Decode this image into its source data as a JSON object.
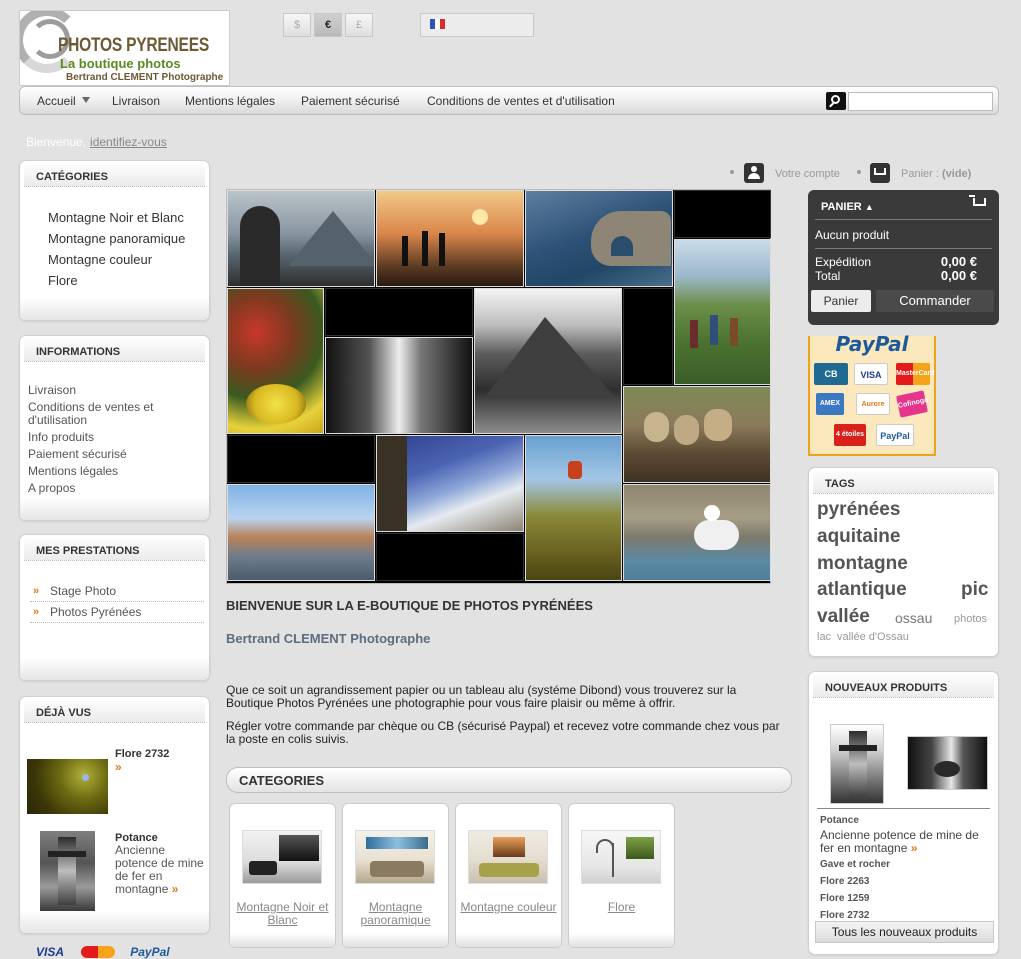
{
  "header": {
    "logo": {
      "title": "PHOTOS PYRENEES",
      "tagline": "La boutique photos",
      "author": "Bertrand CLEMENT Photographe"
    },
    "currencies": [
      "$",
      "€",
      "£"
    ],
    "active_currency": "€",
    "language_flag": "flag-fr-icon"
  },
  "nav": {
    "items": [
      "Accueil",
      "Livraison",
      "Mentions légales",
      "Paiement sécurisé",
      "Conditions de ventes et d'utilisation"
    ],
    "search_placeholder": ""
  },
  "welcome": {
    "text": "Bienvenue,",
    "login_link": "identifiez-vous"
  },
  "categories_box": {
    "title": "CATÉGORIES",
    "items": [
      "Montagne Noir et Blanc",
      "Montagne panoramique",
      "Montagne couleur",
      "Flore"
    ]
  },
  "informations_box": {
    "title": "INFORMATIONS",
    "items": [
      "Livraison",
      "Conditions de ventes et d'utilisation",
      "Info produits",
      "Paiement sécurisé",
      "Mentions légales",
      "A propos"
    ]
  },
  "prestations_box": {
    "title": "MES PRESTATIONS",
    "items": [
      "Stage Photo",
      "Photos Pyrénées"
    ]
  },
  "viewed_box": {
    "title": "DÉJÀ VUS",
    "items": [
      {
        "title": "Flore 2732",
        "desc": ""
      },
      {
        "title": "Potance",
        "desc": "Ancienne potence de mine de fer en montagne"
      }
    ]
  },
  "account_bar": {
    "account": "Votre compte",
    "cart_label": "Panier :",
    "cart_state": "(vide)"
  },
  "main": {
    "title": "BIENVENUE SUR LA E-BOUTIQUE DE PHOTOS PYRÉNÉES",
    "subtitle": "Bertrand CLEMENT Photographe",
    "para1": "Que ce soit un agrandissement papier ou un tableau alu (systéme Dibond) vous trouverez sur la Boutique Photos Pyrénées une photographie pour vous faire plaisir ou même à offrir.",
    "para2": "Régler votre commande par chèque ou CB (sécurisé Paypal) et recevez votre commande chez vous par la poste en colis suivis.",
    "categories_title": "CATEGORIES",
    "category_cards": [
      "Montagne Noir et Blanc",
      "Montagne panoramique",
      "Montagne couleur",
      "Flore"
    ]
  },
  "cart": {
    "title": "PANIER",
    "empty": "Aucun produit",
    "shipping_label": "Expédition",
    "shipping_value": "0,00 €",
    "total_label": "Total",
    "total_value": "0,00 €",
    "btn_cart": "Panier",
    "btn_order": "Commander"
  },
  "payment": {
    "paypal": "PayPal",
    "cards": [
      "CB",
      "VISA",
      "MasterCard",
      "AMEX",
      "Aurore",
      "Cofinoga",
      "4 étoiles",
      "PayPal"
    ]
  },
  "tags_box": {
    "title": "TAGS",
    "tags": [
      "pyrénées",
      "aquitaine",
      "montagne",
      "atlantique",
      "pic",
      "vallée",
      "ossau",
      "photos",
      "lac",
      "vallée d'Ossau"
    ]
  },
  "new_products_box": {
    "title": "NOUVEAUX PRODUITS",
    "featured_title": "Potance",
    "featured_desc": "Ancienne potence de mine de fer en montagne",
    "items": [
      "Gave et rocher",
      "Flore 2263",
      "Flore 1259",
      "Flore 2732"
    ],
    "all_button": "Tous les nouveaux produits"
  },
  "footer": {
    "cards": [
      "VISA",
      "MasterCard",
      "PayPal"
    ]
  }
}
